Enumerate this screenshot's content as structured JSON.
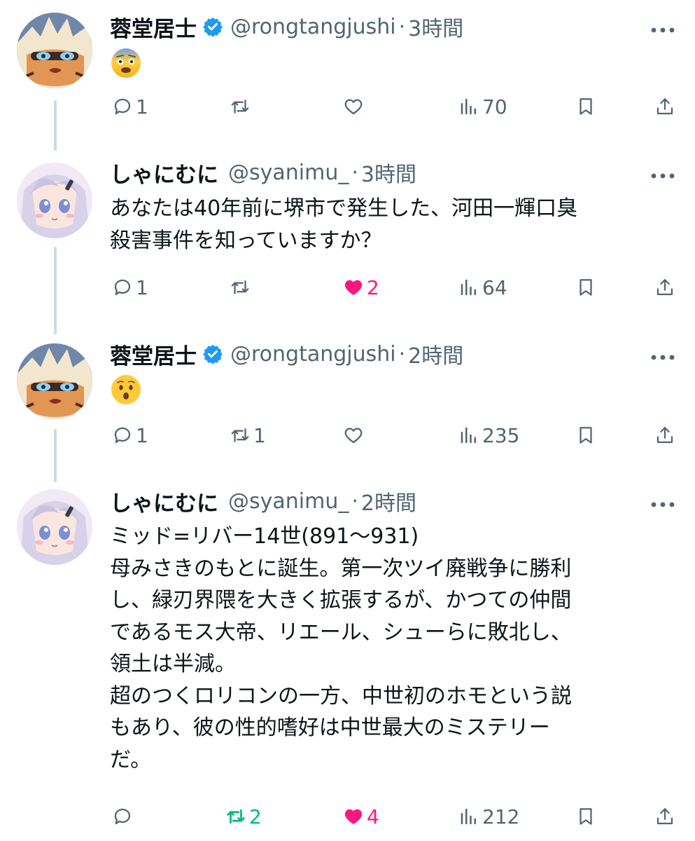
{
  "colors": {
    "text": "#0f1419",
    "secondary": "#536471",
    "verified": "#1d9bf0",
    "like": "#f91880",
    "retweet": "#00ba7c",
    "thread_line": "#cfd9de"
  },
  "icons": {
    "reply": "reply-icon",
    "retweet": "retweet-icon",
    "like": "heart-icon",
    "views": "views-icon",
    "bookmark": "bookmark-icon",
    "share": "share-icon",
    "more": "more-icon",
    "verified": "verified-icon"
  },
  "tweets": [
    {
      "name": "蓉堂居士",
      "verified": true,
      "handle": "@rongtangjushi",
      "dot": "·",
      "time": "3時間",
      "emoji": "fearful-face-emoji",
      "text": "",
      "replies": "1",
      "retweets": "",
      "likes": "",
      "liked": false,
      "retweeted": false,
      "views": "70"
    },
    {
      "name": "しゃにむに",
      "verified": false,
      "handle": "@syanimu_",
      "dot": "·",
      "time": "3時間",
      "emoji": "",
      "text": "あなたは40年前に堺市で発生した、河田一輝口臭\n殺害事件を知っていますか？",
      "replies": "1",
      "retweets": "",
      "likes": "2",
      "liked": true,
      "retweeted": false,
      "views": "64"
    },
    {
      "name": "蓉堂居士",
      "verified": true,
      "handle": "@rongtangjushi",
      "dot": "·",
      "time": "2時間",
      "emoji": "hushed-face-emoji",
      "text": "",
      "replies": "1",
      "retweets": "1",
      "likes": "",
      "liked": false,
      "retweeted": false,
      "views": "235"
    },
    {
      "name": "しゃにむに",
      "verified": false,
      "handle": "@syanimu_",
      "dot": "·",
      "time": "2時間",
      "emoji": "",
      "text": "ミッド=リバー14世(891〜931)\n母みさきのもとに誕生。第一次ツイ廃戦争に勝利\nし、緑刃界隈を大きく拡張するが、かつての仲間\nであるモス大帝、リエール、シューらに敗北し、\n領土は半減。\n超のつくロリコンの一方、中世初のホモという説\nもあり、彼の性的嗜好は中世最大のミステリー\nだ。",
      "replies": "",
      "retweets": "2",
      "likes": "4",
      "liked": true,
      "retweeted": true,
      "views": "212"
    }
  ]
}
